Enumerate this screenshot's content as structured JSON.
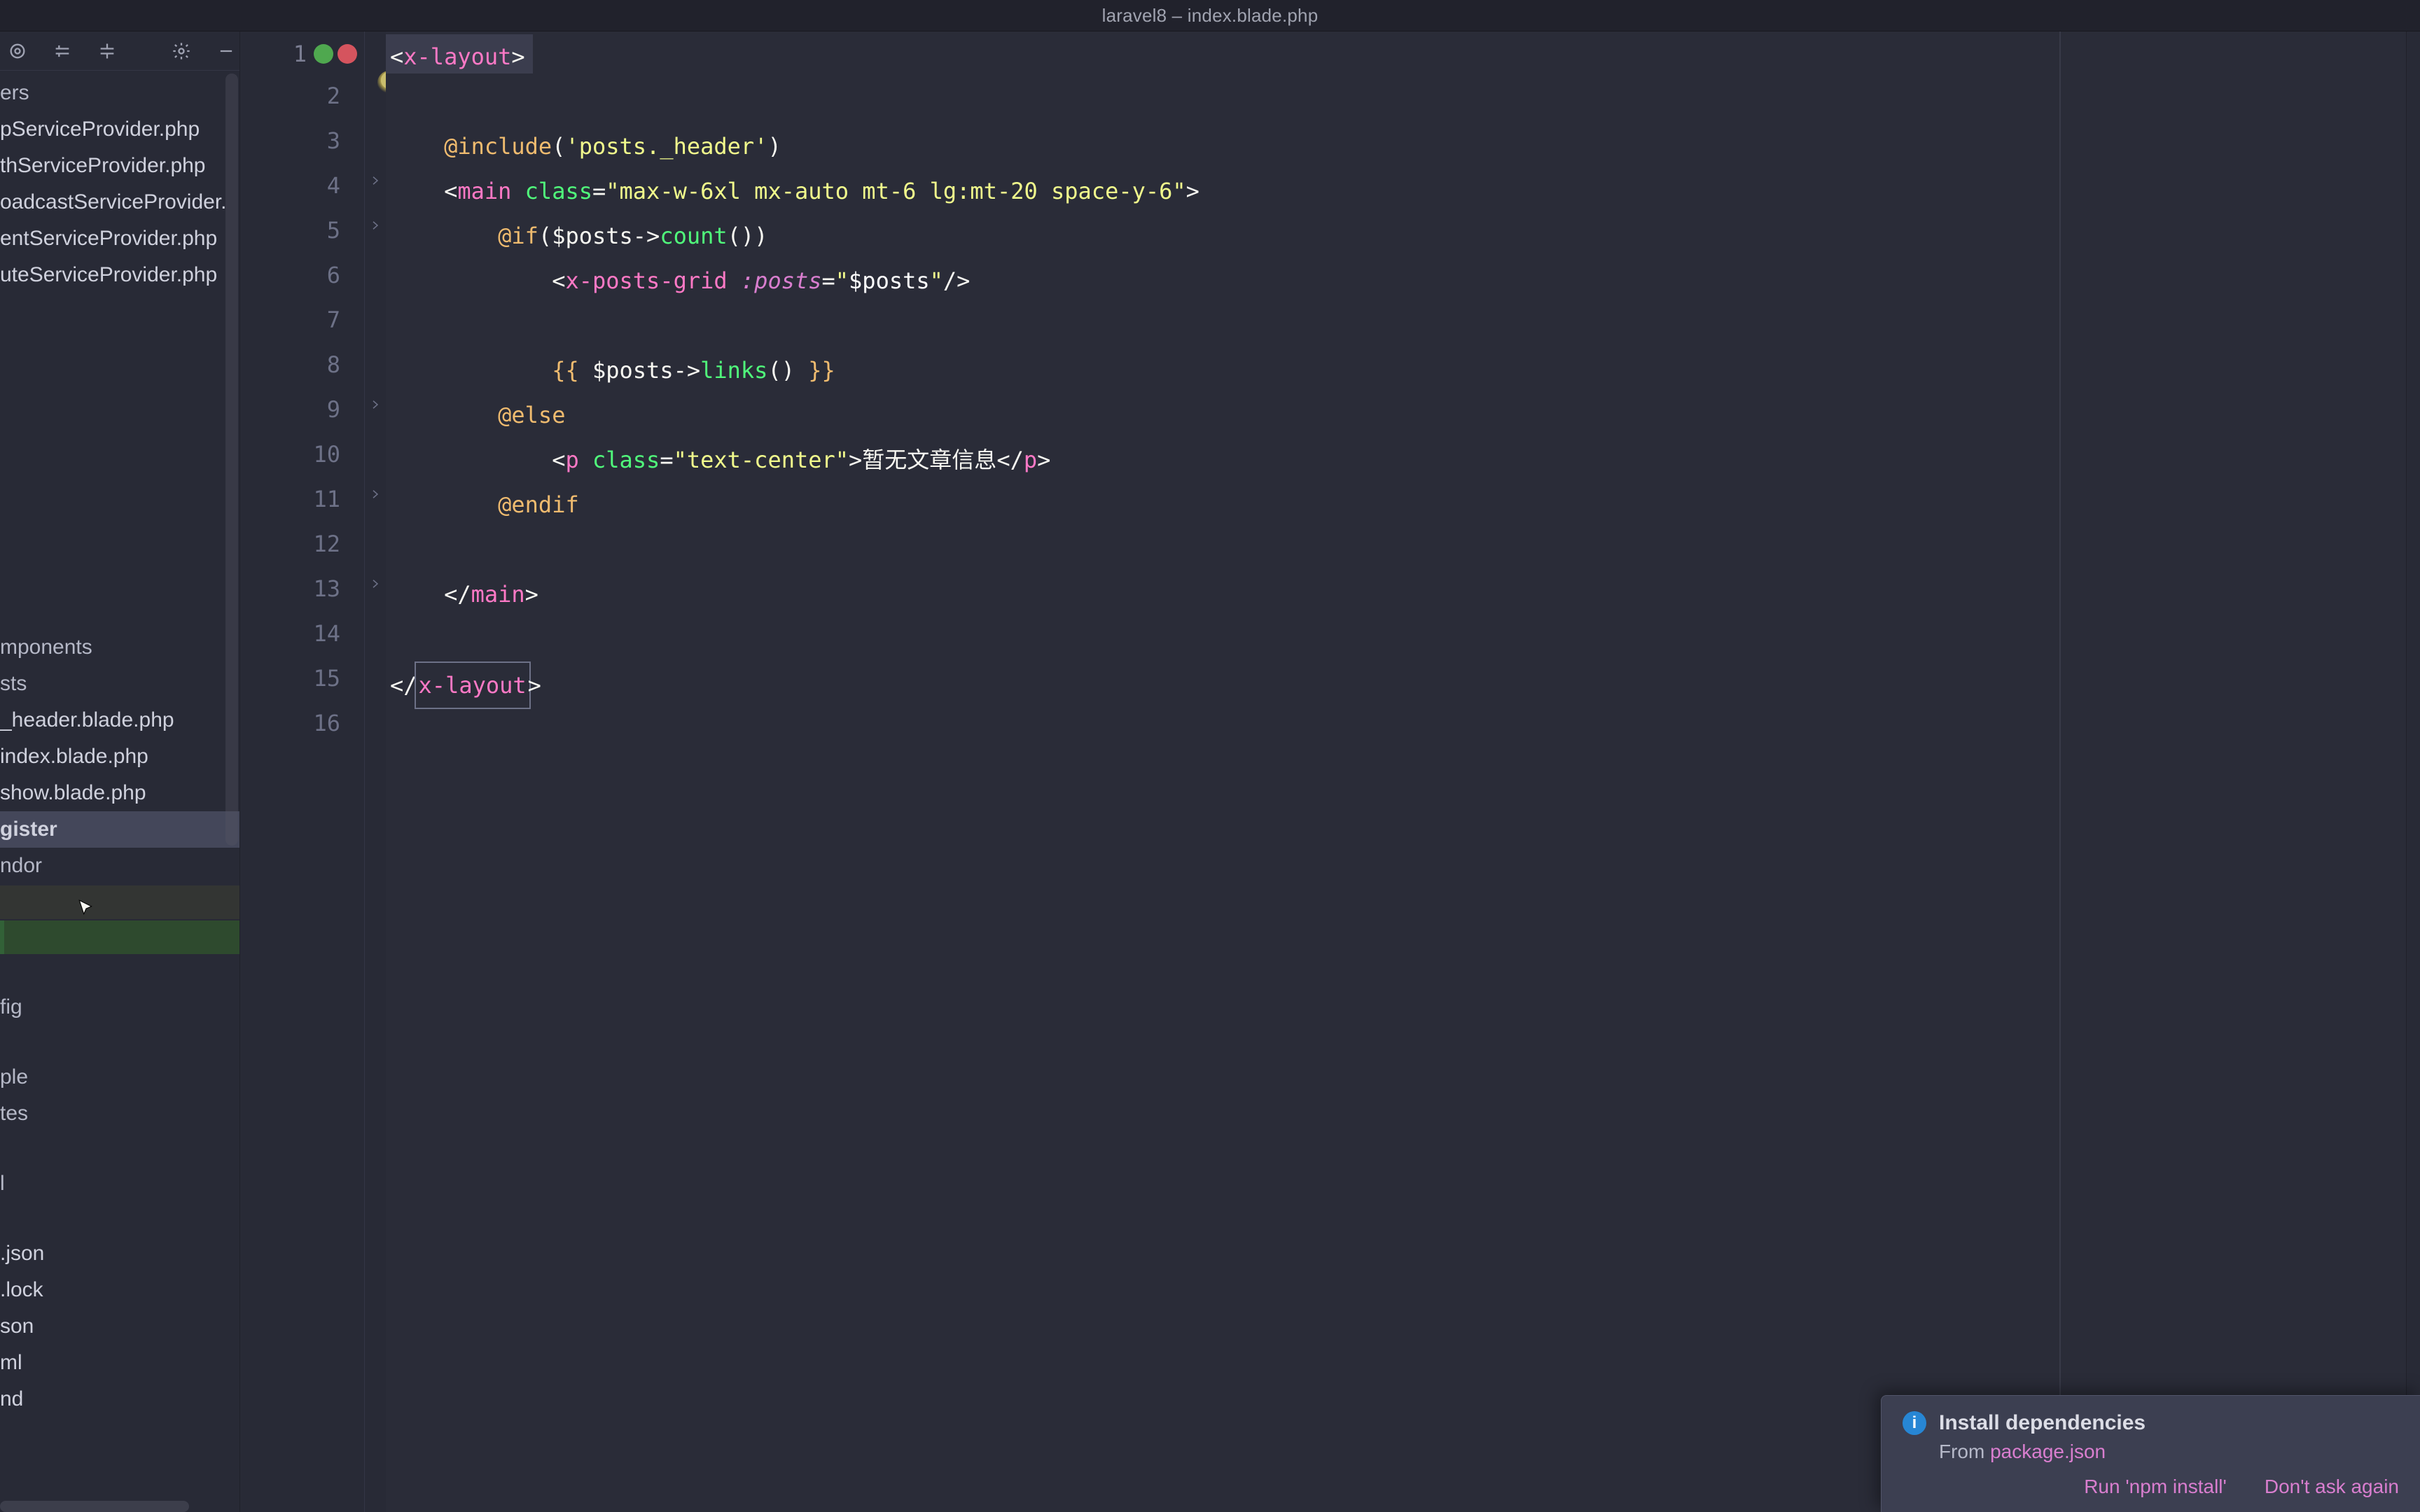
{
  "window": {
    "title": "laravel8 – index.blade.php"
  },
  "sidebar": {
    "items": [
      {
        "label": "ers",
        "kind": "folder"
      },
      {
        "label": "pServiceProvider.php",
        "kind": "file"
      },
      {
        "label": "thServiceProvider.php",
        "kind": "file"
      },
      {
        "label": "oadcastServiceProvider.",
        "kind": "file"
      },
      {
        "label": "entServiceProvider.php",
        "kind": "file"
      },
      {
        "label": "uteServiceProvider.php",
        "kind": "file"
      },
      {
        "label": "",
        "kind": "gap"
      },
      {
        "label": "",
        "kind": "gap"
      },
      {
        "label": "",
        "kind": "gap"
      },
      {
        "label": "",
        "kind": "gap"
      },
      {
        "label": "",
        "kind": "gap"
      },
      {
        "label": "",
        "kind": "gap"
      },
      {
        "label": "",
        "kind": "gap"
      },
      {
        "label": "",
        "kind": "gap"
      },
      {
        "label": "",
        "kind": "gap"
      },
      {
        "label": "",
        "kind": "gap"
      },
      {
        "label": "mponents",
        "kind": "folder"
      },
      {
        "label": "sts",
        "kind": "folder"
      },
      {
        "label": "_header.blade.php",
        "kind": "file"
      },
      {
        "label": "index.blade.php",
        "kind": "file"
      },
      {
        "label": "show.blade.php",
        "kind": "file"
      },
      {
        "label": "gister",
        "kind": "folder",
        "selected": true
      },
      {
        "label": "ndor",
        "kind": "folder"
      },
      {
        "label": "",
        "kind": "gap-yellow"
      },
      {
        "label": "",
        "kind": "gap-green"
      },
      {
        "label": "",
        "kind": "gap"
      },
      {
        "label": "fig",
        "kind": "folder"
      },
      {
        "label": "",
        "kind": "gap"
      },
      {
        "label": "ple",
        "kind": "folder"
      },
      {
        "label": "tes",
        "kind": "folder"
      },
      {
        "label": "",
        "kind": "gap"
      },
      {
        "label": "l",
        "kind": "folder"
      },
      {
        "label": "",
        "kind": "gap"
      },
      {
        "label": ".json",
        "kind": "file"
      },
      {
        "label": ".lock",
        "kind": "file"
      },
      {
        "label": "son",
        "kind": "file"
      },
      {
        "label": "ml",
        "kind": "file"
      },
      {
        "label": "nd",
        "kind": "file"
      }
    ]
  },
  "gutter": {
    "lines": [
      "1",
      "2",
      "3",
      "4",
      "5",
      "6",
      "7",
      "8",
      "9",
      "10",
      "11",
      "12",
      "13",
      "14",
      "15",
      "16"
    ]
  },
  "code": {
    "l1": {
      "open": "<",
      "tag": "x-layout",
      "close": ">"
    },
    "l3": {
      "dir": "@include",
      "open": "(",
      "str": "'posts._header'",
      "close": ")"
    },
    "l4": {
      "lt": "<",
      "tag": "main",
      "sp": " ",
      "attr": "class",
      "eq": "=",
      "val": "\"max-w-6xl mx-auto mt-6 lg:mt-20 space-y-6\"",
      "gt": ">"
    },
    "l5": {
      "dir": "@if",
      "open": "(",
      "var": "$posts",
      "arrow": "->",
      "fn": "count",
      "paren": "()",
      "close": ")"
    },
    "l6": {
      "lt": "<",
      "tag": "x-posts-grid",
      "sp": " ",
      "kwarg": ":posts",
      "eq": "=",
      "val": "\"$posts\"",
      "slash": "/>",
      "varInner": "$posts"
    },
    "l8": {
      "mo": "{{ ",
      "var": "$posts",
      "arrow": "->",
      "fn": "links",
      "paren": "()",
      "mc": " }}"
    },
    "l9": {
      "dir": "@else"
    },
    "l10": {
      "lt": "<",
      "tag": "p",
      "sp": " ",
      "attr": "class",
      "eq": "=",
      "val": "\"text-center\"",
      "gt": ">",
      "text": "暂无文章信息",
      "lt2": "</",
      "tag2": "p",
      "gt2": ">"
    },
    "l11": {
      "dir": "@endif"
    },
    "l13": {
      "lt": "</",
      "tag": "main",
      "gt": ">"
    },
    "l15": {
      "lt": "</",
      "tag": "x-layout",
      "gt": ">"
    }
  },
  "notification": {
    "title": "Install dependencies",
    "from": "From ",
    "package": "package.json",
    "action_run": "Run 'npm install'",
    "action_dismiss": "Don't ask again"
  }
}
